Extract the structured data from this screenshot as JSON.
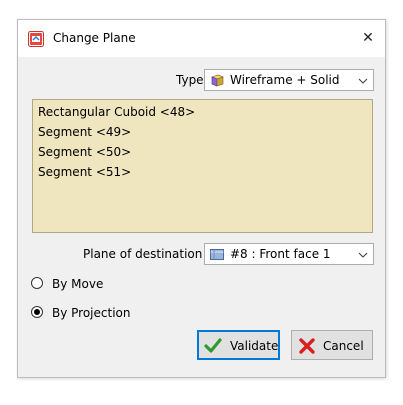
{
  "window": {
    "title": "Change Plane",
    "close_glyph": "✕",
    "icon": "change-plane-app-icon"
  },
  "type_field": {
    "label": "Type",
    "value": "Wireframe + Solid",
    "icon": "wireframe-solid-icon"
  },
  "selection_list": {
    "items": [
      "Rectangular Cuboid <48>",
      "Segment <49>",
      "Segment <50>",
      "Segment <51>"
    ],
    "background": "#efe6c0"
  },
  "destination_field": {
    "label": "Plane of destination",
    "value": "#8 : Front face 1",
    "icon": "plane-icon"
  },
  "mode": {
    "options": [
      "By Move",
      "By Projection"
    ],
    "selected": "By Projection"
  },
  "buttons": {
    "validate_label": "Validate",
    "cancel_label": "Cancel",
    "validate_icon": "green-checkmark-icon",
    "cancel_icon": "red-x-icon"
  },
  "colors": {
    "accent": "#0078d7",
    "validate_green": "#2e9b2e",
    "cancel_red": "#d92020"
  }
}
